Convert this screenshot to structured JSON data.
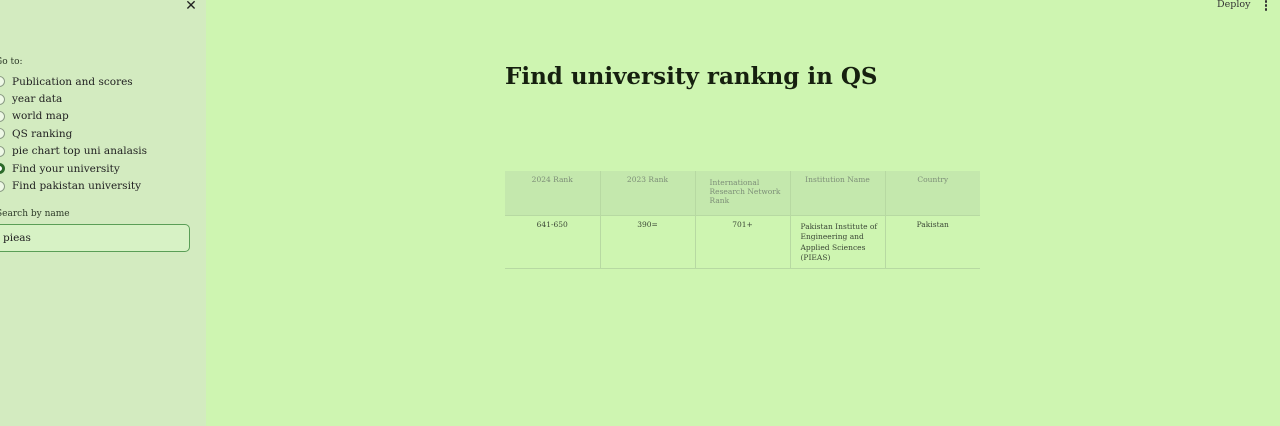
{
  "sidebar": {
    "close_symbol": "✕",
    "nav_label": "Go to:",
    "options": [
      {
        "label": "Publication and scores",
        "checked": false
      },
      {
        "label": "year data",
        "checked": false
      },
      {
        "label": "world map",
        "checked": false
      },
      {
        "label": "QS ranking",
        "checked": false
      },
      {
        "label": "pie chart top uni analasis",
        "checked": false
      },
      {
        "label": "Find your university",
        "checked": true
      },
      {
        "label": "Find pakistan university",
        "checked": false
      }
    ],
    "search_label": "Search by name",
    "search_value": "pieas"
  },
  "header": {
    "deploy_label": "Deploy",
    "menu_icon": "vertical-dots-icon"
  },
  "main": {
    "title": "Find university rankng in QS",
    "table": {
      "columns": [
        "2024 Rank",
        "2023 Rank",
        "International Research Network Rank",
        "Institution Name",
        "Country"
      ],
      "rows": [
        [
          "641-650",
          "390=",
          "701+",
          "Pakistan Institute of Engineering and Applied Sciences (PIEAS)",
          "Pakistan"
        ]
      ]
    }
  },
  "colors": {
    "background": "#cef5b1",
    "sidebar": "#d3ebc0",
    "accent": "#2c6a2a"
  }
}
